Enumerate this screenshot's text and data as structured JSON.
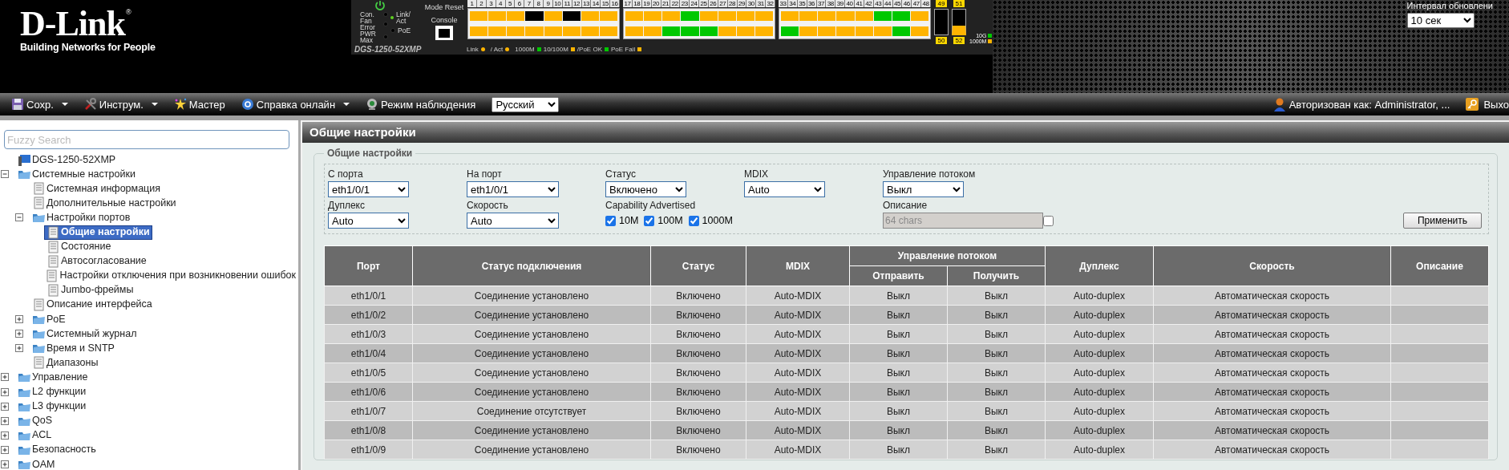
{
  "header": {
    "logo": "D-Link",
    "logo_mark": "®",
    "tagline": "Building Networks for People",
    "refresh": {
      "label": "Интервал обновлени",
      "value": "10 сек"
    }
  },
  "device_panel": {
    "model": "DGS-1250-52XMP",
    "mode_reset": "Mode Reset",
    "console": "Console",
    "leds": [
      {
        "label": "Con.",
        "kind": "system",
        "on": false
      },
      {
        "label": "Fan Error",
        "kind": "system",
        "on": false
      },
      {
        "label": "PWR Max",
        "kind": "system",
        "on": false
      },
      {
        "label": "Link/ Act",
        "kind": "port",
        "on": true
      },
      {
        "label": "PoE",
        "kind": "port",
        "on": false
      }
    ],
    "port_blocks": [
      {
        "numbers": [
          "1",
          "2",
          "3",
          "4",
          "5",
          "6",
          "7",
          "8",
          "9",
          "10",
          "11",
          "12",
          "13",
          "14",
          "15",
          "16"
        ],
        "rows": [
          {
            "leds": [
              {
                "color": "#ffb400"
              },
              {
                "color": "#ffb400"
              },
              {
                "color": "#ffb400"
              },
              {
                "color": "#000000"
              },
              {
                "color": "#ffb400"
              },
              {
                "color": "#000000"
              },
              {
                "color": "#ffb400"
              },
              {
                "color": "#ffb400"
              }
            ]
          },
          {
            "leds": [
              {
                "color": "#ffb400"
              },
              {
                "color": "#ffb400"
              },
              {
                "color": "#ffb400"
              },
              {
                "color": "#ffb400"
              },
              {
                "color": "#ffb400"
              },
              {
                "color": "#ffb400"
              },
              {
                "color": "#ffb400"
              },
              {
                "color": "#ffb400"
              }
            ]
          }
        ]
      },
      {
        "numbers": [
          "17",
          "18",
          "19",
          "20",
          "21",
          "22",
          "23",
          "24",
          "25",
          "26",
          "27",
          "28",
          "29",
          "30",
          "31",
          "32"
        ],
        "rows": [
          {
            "leds": [
              {
                "color": "#ffb400"
              },
              {
                "color": "#ffb400"
              },
              {
                "color": "#ffb400"
              },
              {
                "color": "#00c800"
              },
              {
                "color": "#ffb400"
              },
              {
                "color": "#ffb400"
              },
              {
                "color": "#ffb400"
              },
              {
                "color": "#ffb400"
              }
            ]
          },
          {
            "leds": [
              {
                "color": "#ffb400"
              },
              {
                "color": "#ffb400"
              },
              {
                "color": "#00c800"
              },
              {
                "color": "#00c800"
              },
              {
                "color": "#00c800"
              },
              {
                "color": "#ffb400"
              },
              {
                "color": "#ffb400"
              },
              {
                "color": "#ffb400"
              }
            ]
          }
        ]
      },
      {
        "numbers": [
          "33",
          "34",
          "35",
          "36",
          "37",
          "38",
          "39",
          "40",
          "41",
          "42",
          "43",
          "44",
          "45",
          "46",
          "47",
          "48"
        ],
        "rows": [
          {
            "leds": [
              {
                "color": "#ffb400"
              },
              {
                "color": "#ffb400"
              },
              {
                "color": "#ffb400"
              },
              {
                "color": "#ffb400"
              },
              {
                "color": "#ffb400"
              },
              {
                "color": "#00c800"
              },
              {
                "color": "#00c800"
              },
              {
                "color": "#ffb400"
              }
            ]
          },
          {
            "leds": [
              {
                "color": "#00c800"
              },
              {
                "color": "#ffb400"
              },
              {
                "color": "#ffb400"
              },
              {
                "color": "#ffb400"
              },
              {
                "color": "#ffb400"
              },
              {
                "color": "#ffb400"
              },
              {
                "color": "#00c800"
              },
              {
                "color": "#ffb400"
              }
            ]
          }
        ]
      }
    ],
    "uplinks": [
      {
        "top_label": "49",
        "bottom_label": "50",
        "active": false
      },
      {
        "top_label": "51",
        "bottom_label": "52",
        "active": true
      }
    ],
    "speed_legend": [
      {
        "label": "10G",
        "color": "#00c800"
      },
      {
        "label": "1000M",
        "color": "#ffb400"
      }
    ],
    "legend": [
      {
        "label": "Link",
        "color": "#ffb400"
      },
      {
        "label": "/ Act",
        "color": "#ffb400"
      },
      {
        "label": "1000M",
        "color": "#00c800"
      },
      {
        "label": "10/100M",
        "color": "#ffb400"
      },
      {
        "label": "/PoE OK",
        "color": "#00c800"
      },
      {
        "label": "PoE Fail",
        "color": "#ffb400"
      }
    ]
  },
  "toolbar": {
    "items": [
      {
        "label": "Сохр.",
        "kind": "save",
        "dropdown": true
      },
      {
        "label": "Инструм.",
        "kind": "tools",
        "dropdown": true
      },
      {
        "label": "Мастер",
        "kind": "wizard",
        "dropdown": false
      },
      {
        "label": "Справка онлайн",
        "kind": "help",
        "dropdown": true
      },
      {
        "label": "Режим наблюдения",
        "kind": "monitor",
        "dropdown": false
      }
    ],
    "language": "Русский",
    "user": "Авторизован как: Administrator, ...",
    "logout": "Выхо"
  },
  "sidebar": {
    "search": {
      "placeholder": "Fuzzy Search"
    },
    "tree": [
      {
        "label": "DGS-1250-52XMP",
        "kind": "device",
        "selected": false
      },
      {
        "label": "Системные настройки",
        "kind": "folder",
        "expanded": true,
        "selected": false,
        "children": [
          {
            "label": "Системная информация",
            "kind": "page",
            "selected": false
          },
          {
            "label": "Дополнительные настройки",
            "kind": "page",
            "selected": false
          },
          {
            "label": "Настройки портов",
            "kind": "folder",
            "expanded": true,
            "selected": false,
            "children": [
              {
                "label": "Общие настройки",
                "kind": "page",
                "selected": true
              },
              {
                "label": "Состояние",
                "kind": "page",
                "selected": false
              },
              {
                "label": "Автосогласование",
                "kind": "page",
                "selected": false
              },
              {
                "label": "Настройки отключения при возникновении ошибок",
                "kind": "page",
                "selected": false
              },
              {
                "label": "Jumbo-фреймы",
                "kind": "page",
                "selected": false
              }
            ]
          },
          {
            "label": "Описание интерфейса",
            "kind": "page",
            "selected": false
          },
          {
            "label": "PoE",
            "kind": "folder",
            "expanded": false,
            "selected": false
          },
          {
            "label": "Системный журнал",
            "kind": "folder",
            "expanded": false,
            "selected": false
          },
          {
            "label": "Время и SNTP",
            "kind": "folder",
            "expanded": false,
            "selected": false
          },
          {
            "label": "Диапазоны",
            "kind": "page",
            "selected": false
          }
        ]
      },
      {
        "label": "Управление",
        "kind": "folder",
        "expanded": false,
        "selected": false
      },
      {
        "label": "L2 функции",
        "kind": "folder",
        "expanded": false,
        "selected": false
      },
      {
        "label": "L3 функции",
        "kind": "folder",
        "expanded": false,
        "selected": false
      },
      {
        "label": "QoS",
        "kind": "folder",
        "expanded": false,
        "selected": false
      },
      {
        "label": "ACL",
        "kind": "folder",
        "expanded": false,
        "selected": false
      },
      {
        "label": "Безопасность",
        "kind": "folder",
        "expanded": false,
        "selected": false
      },
      {
        "label": "OAM",
        "kind": "folder",
        "expanded": false,
        "selected": false
      }
    ]
  },
  "main": {
    "title": "Общие настройки",
    "legend": "Общие настройки",
    "form_rows": [
      {
        "fields": [
          {
            "label": "С порта",
            "kind": "select",
            "value": "eth1/0/1"
          },
          {
            "label": "На порт",
            "kind": "select",
            "value": "eth1/0/1"
          },
          {
            "label": "Статус",
            "kind": "select",
            "value": "Включено"
          },
          {
            "label": "MDIX",
            "kind": "select",
            "value": "Auto"
          },
          {
            "label": "Управление потоком",
            "kind": "select",
            "value": "Выкл"
          }
        ]
      },
      {
        "fields": [
          {
            "label": "Дуплекс",
            "kind": "select",
            "value": "Auto"
          },
          {
            "label": "Скорость",
            "kind": "select",
            "value": "Auto"
          },
          {
            "label": "Capability Advertised",
            "kind": "checks",
            "options": [
              {
                "label": "10M",
                "checked": true
              },
              {
                "label": "100M",
                "checked": true
              },
              {
                "label": "1000M",
                "checked": true
              }
            ]
          },
          {
            "label": "Описание",
            "kind": "text",
            "placeholder": "64 chars",
            "disabled": true,
            "checked": false
          }
        ]
      }
    ],
    "apply": "Применить",
    "table": {
      "columns": [
        {
          "label": "Порт"
        },
        {
          "label": "Статус подключения"
        },
        {
          "label": "Статус"
        },
        {
          "label": "MDIX"
        },
        {
          "label": "Управление потоком",
          "colspan": 2,
          "children": [
            {
              "label": "Отправить"
            },
            {
              "label": "Получить"
            }
          ]
        },
        {
          "label": "Дуплекс"
        },
        {
          "label": "Скорость"
        },
        {
          "label": "Описание"
        }
      ],
      "rows": [
        {
          "cells": [
            "eth1/0/1",
            "Соединение установлено",
            "Включено",
            "Auto-MDIX",
            "Выкл",
            "Выкл",
            "Auto-duplex",
            "Автоматическая скорость"
          ]
        },
        {
          "cells": [
            "eth1/0/2",
            "Соединение установлено",
            "Включено",
            "Auto-MDIX",
            "Выкл",
            "Выкл",
            "Auto-duplex",
            "Автоматическая скорость"
          ]
        },
        {
          "cells": [
            "eth1/0/3",
            "Соединение установлено",
            "Включено",
            "Auto-MDIX",
            "Выкл",
            "Выкл",
            "Auto-duplex",
            "Автоматическая скорость"
          ]
        },
        {
          "cells": [
            "eth1/0/4",
            "Соединение установлено",
            "Включено",
            "Auto-MDIX",
            "Выкл",
            "Выкл",
            "Auto-duplex",
            "Автоматическая скорость"
          ]
        },
        {
          "cells": [
            "eth1/0/5",
            "Соединение установлено",
            "Включено",
            "Auto-MDIX",
            "Выкл",
            "Выкл",
            "Auto-duplex",
            "Автоматическая скорость"
          ]
        },
        {
          "cells": [
            "eth1/0/6",
            "Соединение установлено",
            "Включено",
            "Auto-MDIX",
            "Выкл",
            "Выкл",
            "Auto-duplex",
            "Автоматическая скорость"
          ]
        },
        {
          "cells": [
            "eth1/0/7",
            "Соединение отсутствует",
            "Включено",
            "Auto-MDIX",
            "Выкл",
            "Выкл",
            "Auto-duplex",
            "Автоматическая скорость"
          ]
        },
        {
          "cells": [
            "eth1/0/8",
            "Соединение установлено",
            "Включено",
            "Auto-MDIX",
            "Выкл",
            "Выкл",
            "Auto-duplex",
            "Автоматическая скорость"
          ]
        },
        {
          "cells": [
            "eth1/0/9",
            "Соединение установлено",
            "Включено",
            "Auto-MDIX",
            "Выкл",
            "Выкл",
            "Auto-duplex",
            "Автоматическая скорость"
          ]
        }
      ]
    }
  }
}
